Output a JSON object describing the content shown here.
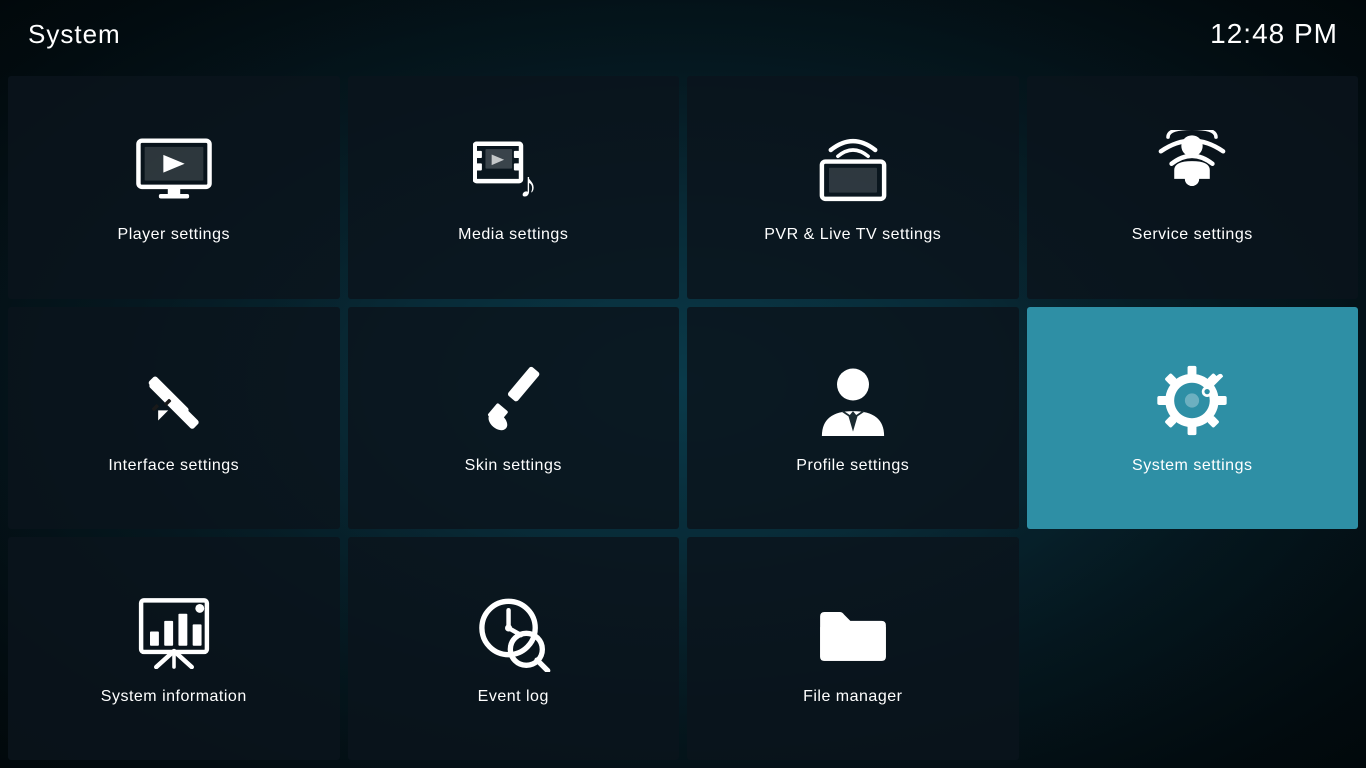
{
  "header": {
    "title": "System",
    "time": "12:48 PM"
  },
  "grid": {
    "items": [
      {
        "id": "player-settings",
        "label": "Player settings",
        "icon": "player",
        "active": false,
        "row": 1,
        "col": 1
      },
      {
        "id": "media-settings",
        "label": "Media settings",
        "icon": "media",
        "active": false,
        "row": 1,
        "col": 2
      },
      {
        "id": "pvr-settings",
        "label": "PVR & Live TV settings",
        "icon": "pvr",
        "active": false,
        "row": 1,
        "col": 3
      },
      {
        "id": "service-settings",
        "label": "Service settings",
        "icon": "service",
        "active": false,
        "row": 1,
        "col": 4
      },
      {
        "id": "interface-settings",
        "label": "Interface settings",
        "icon": "interface",
        "active": false,
        "row": 2,
        "col": 1
      },
      {
        "id": "skin-settings",
        "label": "Skin settings",
        "icon": "skin",
        "active": false,
        "row": 2,
        "col": 2
      },
      {
        "id": "profile-settings",
        "label": "Profile settings",
        "icon": "profile",
        "active": false,
        "row": 2,
        "col": 3
      },
      {
        "id": "system-settings",
        "label": "System settings",
        "icon": "system",
        "active": true,
        "row": 2,
        "col": 4
      },
      {
        "id": "system-information",
        "label": "System information",
        "icon": "sysinfo",
        "active": false,
        "row": 3,
        "col": 1
      },
      {
        "id": "event-log",
        "label": "Event log",
        "icon": "eventlog",
        "active": false,
        "row": 3,
        "col": 2
      },
      {
        "id": "file-manager",
        "label": "File manager",
        "icon": "filemanager",
        "active": false,
        "row": 3,
        "col": 3
      },
      {
        "id": "empty",
        "label": "",
        "icon": "none",
        "active": false,
        "row": 3,
        "col": 4
      }
    ]
  }
}
